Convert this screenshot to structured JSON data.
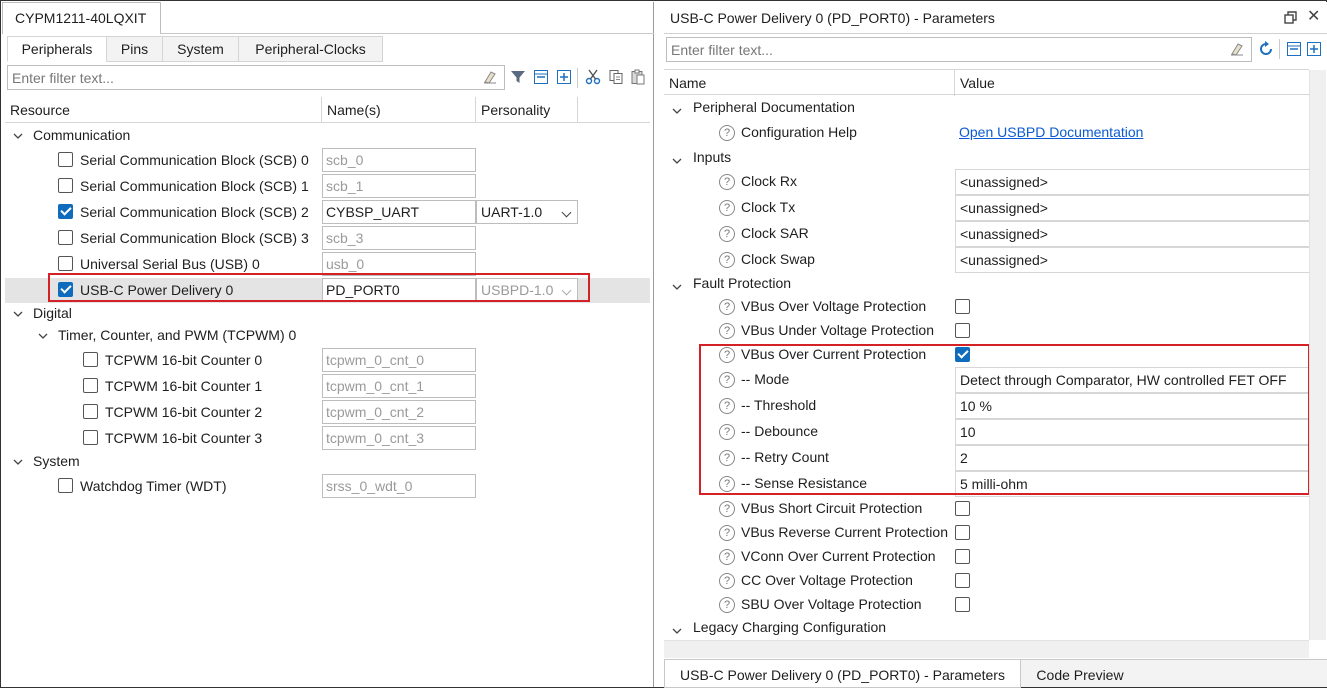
{
  "left": {
    "doc_tab": "CYPM1211-40LQXIT",
    "tabs": [
      "Peripherals",
      "Pins",
      "System",
      "Peripheral-Clocks"
    ],
    "filter_placeholder": "Enter filter text...",
    "columns": {
      "resource": "Resource",
      "names": "Name(s)",
      "personality": "Personality"
    },
    "groups": {
      "communication": "Communication",
      "digital": "Digital",
      "tcpwm": "Timer, Counter, and PWM (TCPWM) 0",
      "system": "System"
    },
    "rows": [
      {
        "label": "Serial Communication Block (SCB) 0",
        "name": "scb_0",
        "checked": false
      },
      {
        "label": "Serial Communication Block (SCB) 1",
        "name": "scb_1",
        "checked": false
      },
      {
        "label": "Serial Communication Block (SCB) 2",
        "name": "CYBSP_UART",
        "checked": true,
        "personality": "UART-1.0"
      },
      {
        "label": "Serial Communication Block (SCB) 3",
        "name": "scb_3",
        "checked": false
      },
      {
        "label": "Universal Serial Bus (USB) 0",
        "name": "usb_0",
        "checked": false
      },
      {
        "label": "USB-C Power Delivery 0",
        "name": "PD_PORT0",
        "checked": true,
        "personality": "USBPD-1.0"
      },
      {
        "label": "TCPWM 16-bit Counter 0",
        "name": "tcpwm_0_cnt_0",
        "checked": false
      },
      {
        "label": "TCPWM 16-bit Counter 1",
        "name": "tcpwm_0_cnt_1",
        "checked": false
      },
      {
        "label": "TCPWM 16-bit Counter 2",
        "name": "tcpwm_0_cnt_2",
        "checked": false
      },
      {
        "label": "TCPWM 16-bit Counter 3",
        "name": "tcpwm_0_cnt_3",
        "checked": false
      },
      {
        "label": "Watchdog Timer (WDT)",
        "name": "srss_0_wdt_0",
        "checked": false
      }
    ]
  },
  "right": {
    "title": "USB-C Power Delivery 0 (PD_PORT0) - Parameters",
    "filter_placeholder": "Enter filter text...",
    "columns": {
      "name": "Name",
      "value": "Value"
    },
    "sections": {
      "doc": "Peripheral Documentation",
      "inputs": "Inputs",
      "fault": "Fault Protection",
      "legacy": "Legacy Charging Configuration"
    },
    "params": {
      "config_help": {
        "label": "Configuration Help",
        "value": "Open USBPD Documentation"
      },
      "clock_rx": {
        "label": "Clock Rx",
        "value": "<unassigned>"
      },
      "clock_tx": {
        "label": "Clock Tx",
        "value": "<unassigned>"
      },
      "clock_sar": {
        "label": "Clock SAR",
        "value": "<unassigned>"
      },
      "clock_swap": {
        "label": "Clock Swap",
        "value": "<unassigned>"
      },
      "vbus_ovp": {
        "label": "VBus Over Voltage Protection",
        "checked": false
      },
      "vbus_uvp": {
        "label": "VBus Under Voltage Protection",
        "checked": false
      },
      "vbus_ocp": {
        "label": "VBus Over Current Protection",
        "checked": true
      },
      "mode": {
        "label": "-- Mode",
        "value": "Detect through Comparator, HW controlled FET OFF"
      },
      "threshold": {
        "label": "-- Threshold",
        "value": "10 %"
      },
      "debounce": {
        "label": "-- Debounce",
        "value": "10"
      },
      "retry": {
        "label": "-- Retry Count",
        "value": "2"
      },
      "sense": {
        "label": "-- Sense Resistance",
        "value": "5 milli-ohm"
      },
      "vbus_scp": {
        "label": "VBus Short Circuit Protection",
        "checked": false
      },
      "vbus_rcp": {
        "label": "VBus Reverse Current Protection",
        "checked": false
      },
      "vconn_ocp": {
        "label": "VConn Over Current Protection",
        "checked": false
      },
      "cc_ovp": {
        "label": "CC Over Voltage Protection",
        "checked": false
      },
      "sbu_ovp": {
        "label": "SBU Over Voltage Protection",
        "checked": false
      }
    },
    "bottom_tabs": [
      "USB-C Power Delivery 0 (PD_PORT0) - Parameters",
      "Code Preview"
    ]
  },
  "colors": {
    "accent": "#0f6cbd",
    "highlight_box": "#d42027",
    "link": "#0a5bd4"
  }
}
